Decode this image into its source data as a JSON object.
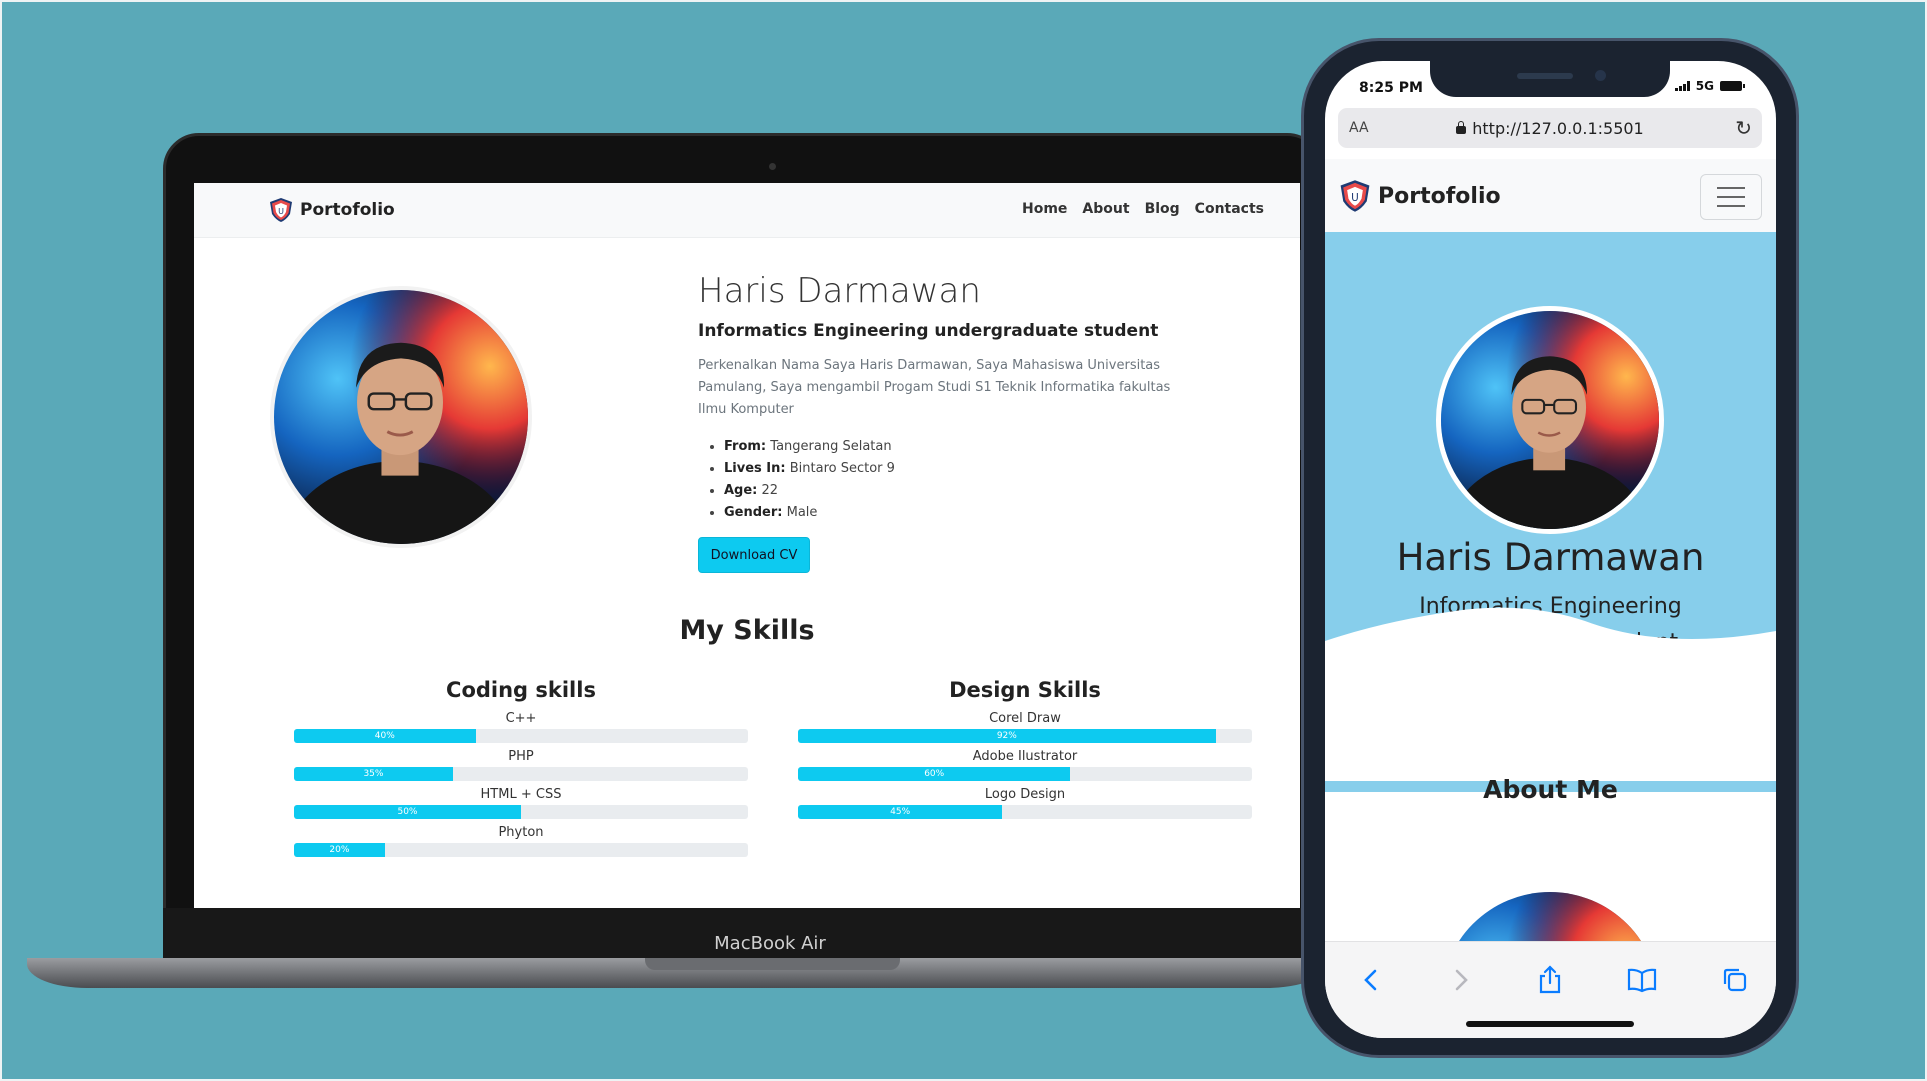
{
  "colors": {
    "background": "#5aa9b8",
    "accent_cyan": "#0dcaf0",
    "hero_sky": "#87ceeb"
  },
  "laptop": {
    "device_label": "MacBook Air",
    "nav": {
      "brand": "Portofolio",
      "brand_icon": "shield-logo-icon",
      "items": [
        {
          "label": "Home"
        },
        {
          "label": "About"
        },
        {
          "label": "Blog"
        },
        {
          "label": "Contacts"
        }
      ]
    },
    "profile": {
      "name": "Haris Darmawan",
      "role": "Informatics Engineering undergraduate student",
      "description": "Perkenalkan Nama Saya Haris Darmawan, Saya Mahasiswa Universitas Pamulang, Saya mengambil Progam Studi S1 Teknik Informatika fakultas Ilmu Komputer",
      "details": [
        {
          "key": "From:",
          "value": "Tangerang Selatan"
        },
        {
          "key": "Lives In:",
          "value": "Bintaro Sector 9"
        },
        {
          "key": "Age:",
          "value": "22"
        },
        {
          "key": "Gender:",
          "value": "Male"
        }
      ],
      "download_label": "Download CV"
    },
    "skills": {
      "title": "My Skills",
      "coding": {
        "title": "Coding skills",
        "items": [
          {
            "name": "C++",
            "percent": 40,
            "label": "40%"
          },
          {
            "name": "PHP",
            "percent": 35,
            "label": "35%"
          },
          {
            "name": "HTML + CSS",
            "percent": 50,
            "label": "50%"
          },
          {
            "name": "Phyton",
            "percent": 20,
            "label": "20%"
          }
        ]
      },
      "design": {
        "title": "Design Skills",
        "items": [
          {
            "name": "Corel Draw",
            "percent": 92,
            "label": "92%"
          },
          {
            "name": "Adobe Ilustrator",
            "percent": 60,
            "label": "60%"
          },
          {
            "name": "Logo Design",
            "percent": 45,
            "label": "45%"
          }
        ]
      }
    }
  },
  "phone": {
    "status": {
      "time": "8:25 PM",
      "network": "5G"
    },
    "browser": {
      "aa": "AA",
      "url": "http://127.0.0.1:5501"
    },
    "nav": {
      "brand": "Portofolio",
      "menu_icon": "hamburger-icon"
    },
    "hero": {
      "name": "Haris Darmawan",
      "role": "Informatics Engineering undergraduate student"
    },
    "about_title": "About Me",
    "toolbar": {
      "icons": [
        "back-icon",
        "forward-icon",
        "share-icon",
        "bookmarks-icon",
        "tabs-icon"
      ]
    }
  }
}
